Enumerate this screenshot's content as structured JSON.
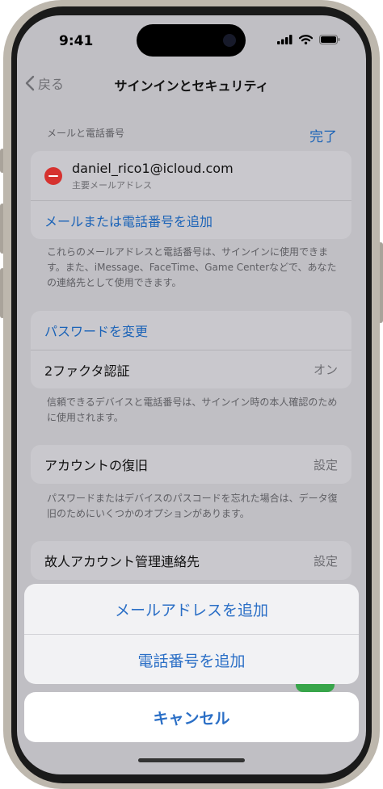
{
  "status_bar": {
    "time": "9:41"
  },
  "nav": {
    "back_label": "戻る",
    "title": "サインインとセキュリティ"
  },
  "email_section": {
    "header": "メールと電話番号",
    "done_label": "完了",
    "email": "daniel_rico1@icloud.com",
    "email_subtitle": "主要メールアドレス",
    "add_label": "メールまたは電話番号を追加",
    "note": "これらのメールアドレスと電話番号は、サインインに使用できます。また、iMessage、FaceTime、Game Centerなどで、あなたの連絡先として使用できます。"
  },
  "security_section": {
    "change_password": "パスワードを変更",
    "two_factor_label": "2ファクタ認証",
    "two_factor_value": "オン",
    "note": "信頼できるデバイスと電話番号は、サインイン時の本人確認のために使用されます。"
  },
  "recovery_section": {
    "label": "アカウントの復旧",
    "value": "設定",
    "note": "パスワードまたはデバイスのパスコードを忘れた場合は、データ復旧のためにいくつかのオプションがあります。"
  },
  "legacy_section": {
    "label": "故人アカウント管理連絡先",
    "value": "設定"
  },
  "action_sheet": {
    "add_email": "メールアドレスを追加",
    "add_phone": "電話番号を追加",
    "cancel": "キャンセル"
  },
  "colors": {
    "accent": "#2b6fc6",
    "destructive": "#d6322f",
    "dim_background": "#c0bfc4"
  }
}
